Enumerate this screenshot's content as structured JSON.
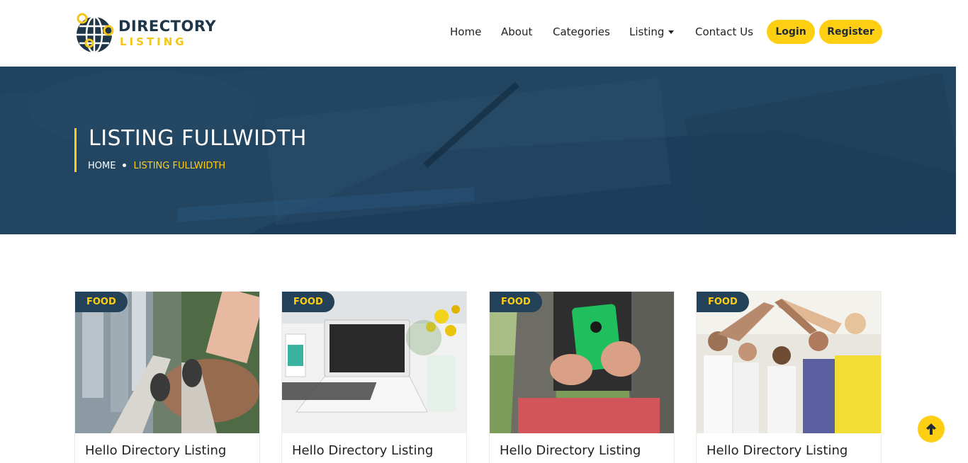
{
  "logo": {
    "line1": "DIRECTORY",
    "line2": "LISTING"
  },
  "nav": {
    "items": [
      {
        "label": "Home"
      },
      {
        "label": "About"
      },
      {
        "label": "Categories"
      },
      {
        "label": "Listing"
      },
      {
        "label": "Contact Us"
      }
    ],
    "login_label": "Login",
    "register_label": "Register"
  },
  "hero": {
    "title": "LISTING FULLWIDTH",
    "breadcrumb": [
      "HOME",
      "LISTING FULLWIDTH"
    ]
  },
  "cards": [
    {
      "tag": "FOOD",
      "title": "Hello Directory Listing"
    },
    {
      "tag": "FOOD",
      "title": "Hello Directory Listing"
    },
    {
      "tag": "FOOD",
      "title": "Hello Directory Listing"
    },
    {
      "tag": "FOOD",
      "title": "Hello Directory Listing"
    }
  ],
  "colors": {
    "accent": "#fdce11",
    "dark": "#23425a",
    "hero": "#2c4f6d"
  },
  "icons": {
    "back_to_top": "arrow-up-icon",
    "logo": "globe-pin-icon",
    "dropdown": "caret-down-icon"
  }
}
